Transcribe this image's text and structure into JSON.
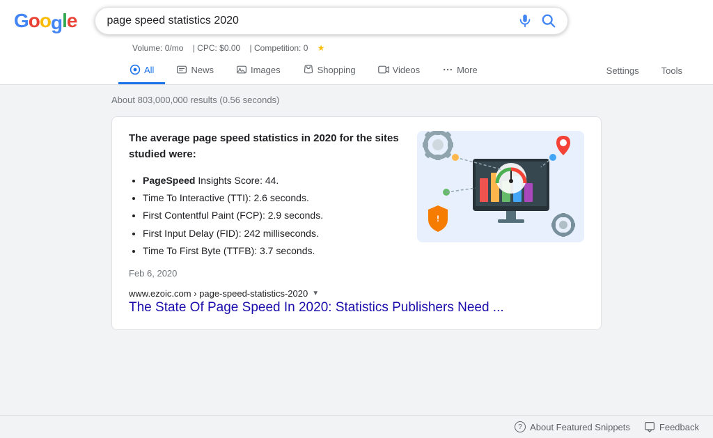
{
  "logo": {
    "letters": [
      {
        "char": "G",
        "color": "#4285F4"
      },
      {
        "char": "o",
        "color": "#EA4335"
      },
      {
        "char": "o",
        "color": "#FBBC05"
      },
      {
        "char": "g",
        "color": "#4285F4"
      },
      {
        "char": "l",
        "color": "#34A853"
      },
      {
        "char": "e",
        "color": "#EA4335"
      }
    ]
  },
  "search": {
    "query": "page speed statistics 2020",
    "placeholder": "Search"
  },
  "volume_bar": {
    "volume": "Volume: 0/mo",
    "cpc": "CPC: $0.00",
    "competition": "Competition: 0"
  },
  "nav": {
    "tabs": [
      {
        "id": "all",
        "label": "All",
        "active": true
      },
      {
        "id": "news",
        "label": "News",
        "active": false
      },
      {
        "id": "images",
        "label": "Images",
        "active": false
      },
      {
        "id": "shopping",
        "label": "Shopping",
        "active": false
      },
      {
        "id": "videos",
        "label": "Videos",
        "active": false
      },
      {
        "id": "more",
        "label": "More",
        "active": false
      }
    ],
    "right": [
      {
        "id": "settings",
        "label": "Settings"
      },
      {
        "id": "tools",
        "label": "Tools"
      }
    ]
  },
  "results": {
    "count": "About 803,000,000 results (0.56 seconds)"
  },
  "snippet": {
    "title": "The average page speed statistics in 2020 for the sites studied were:",
    "bullets": [
      {
        "bold": "PageSpeed",
        "rest": " Insights Score: 44."
      },
      {
        "bold": "",
        "rest": "Time To Interactive (TTI): 2.6 seconds."
      },
      {
        "bold": "",
        "rest": "First Contentful Paint (FCP): 2.9 seconds."
      },
      {
        "bold": "",
        "rest": "First Input Delay (FID): 242 milliseconds."
      },
      {
        "bold": "",
        "rest": "Time To First Byte (TTFB): 3.7 seconds."
      }
    ],
    "date": "Feb 6, 2020",
    "url": "www.ezoic.com › page-speed-statistics-2020",
    "link_text": "The State Of Page Speed In 2020: Statistics Publishers Need ..."
  },
  "bottom": {
    "about_snippets": "About Featured Snippets",
    "feedback": "Feedback"
  }
}
